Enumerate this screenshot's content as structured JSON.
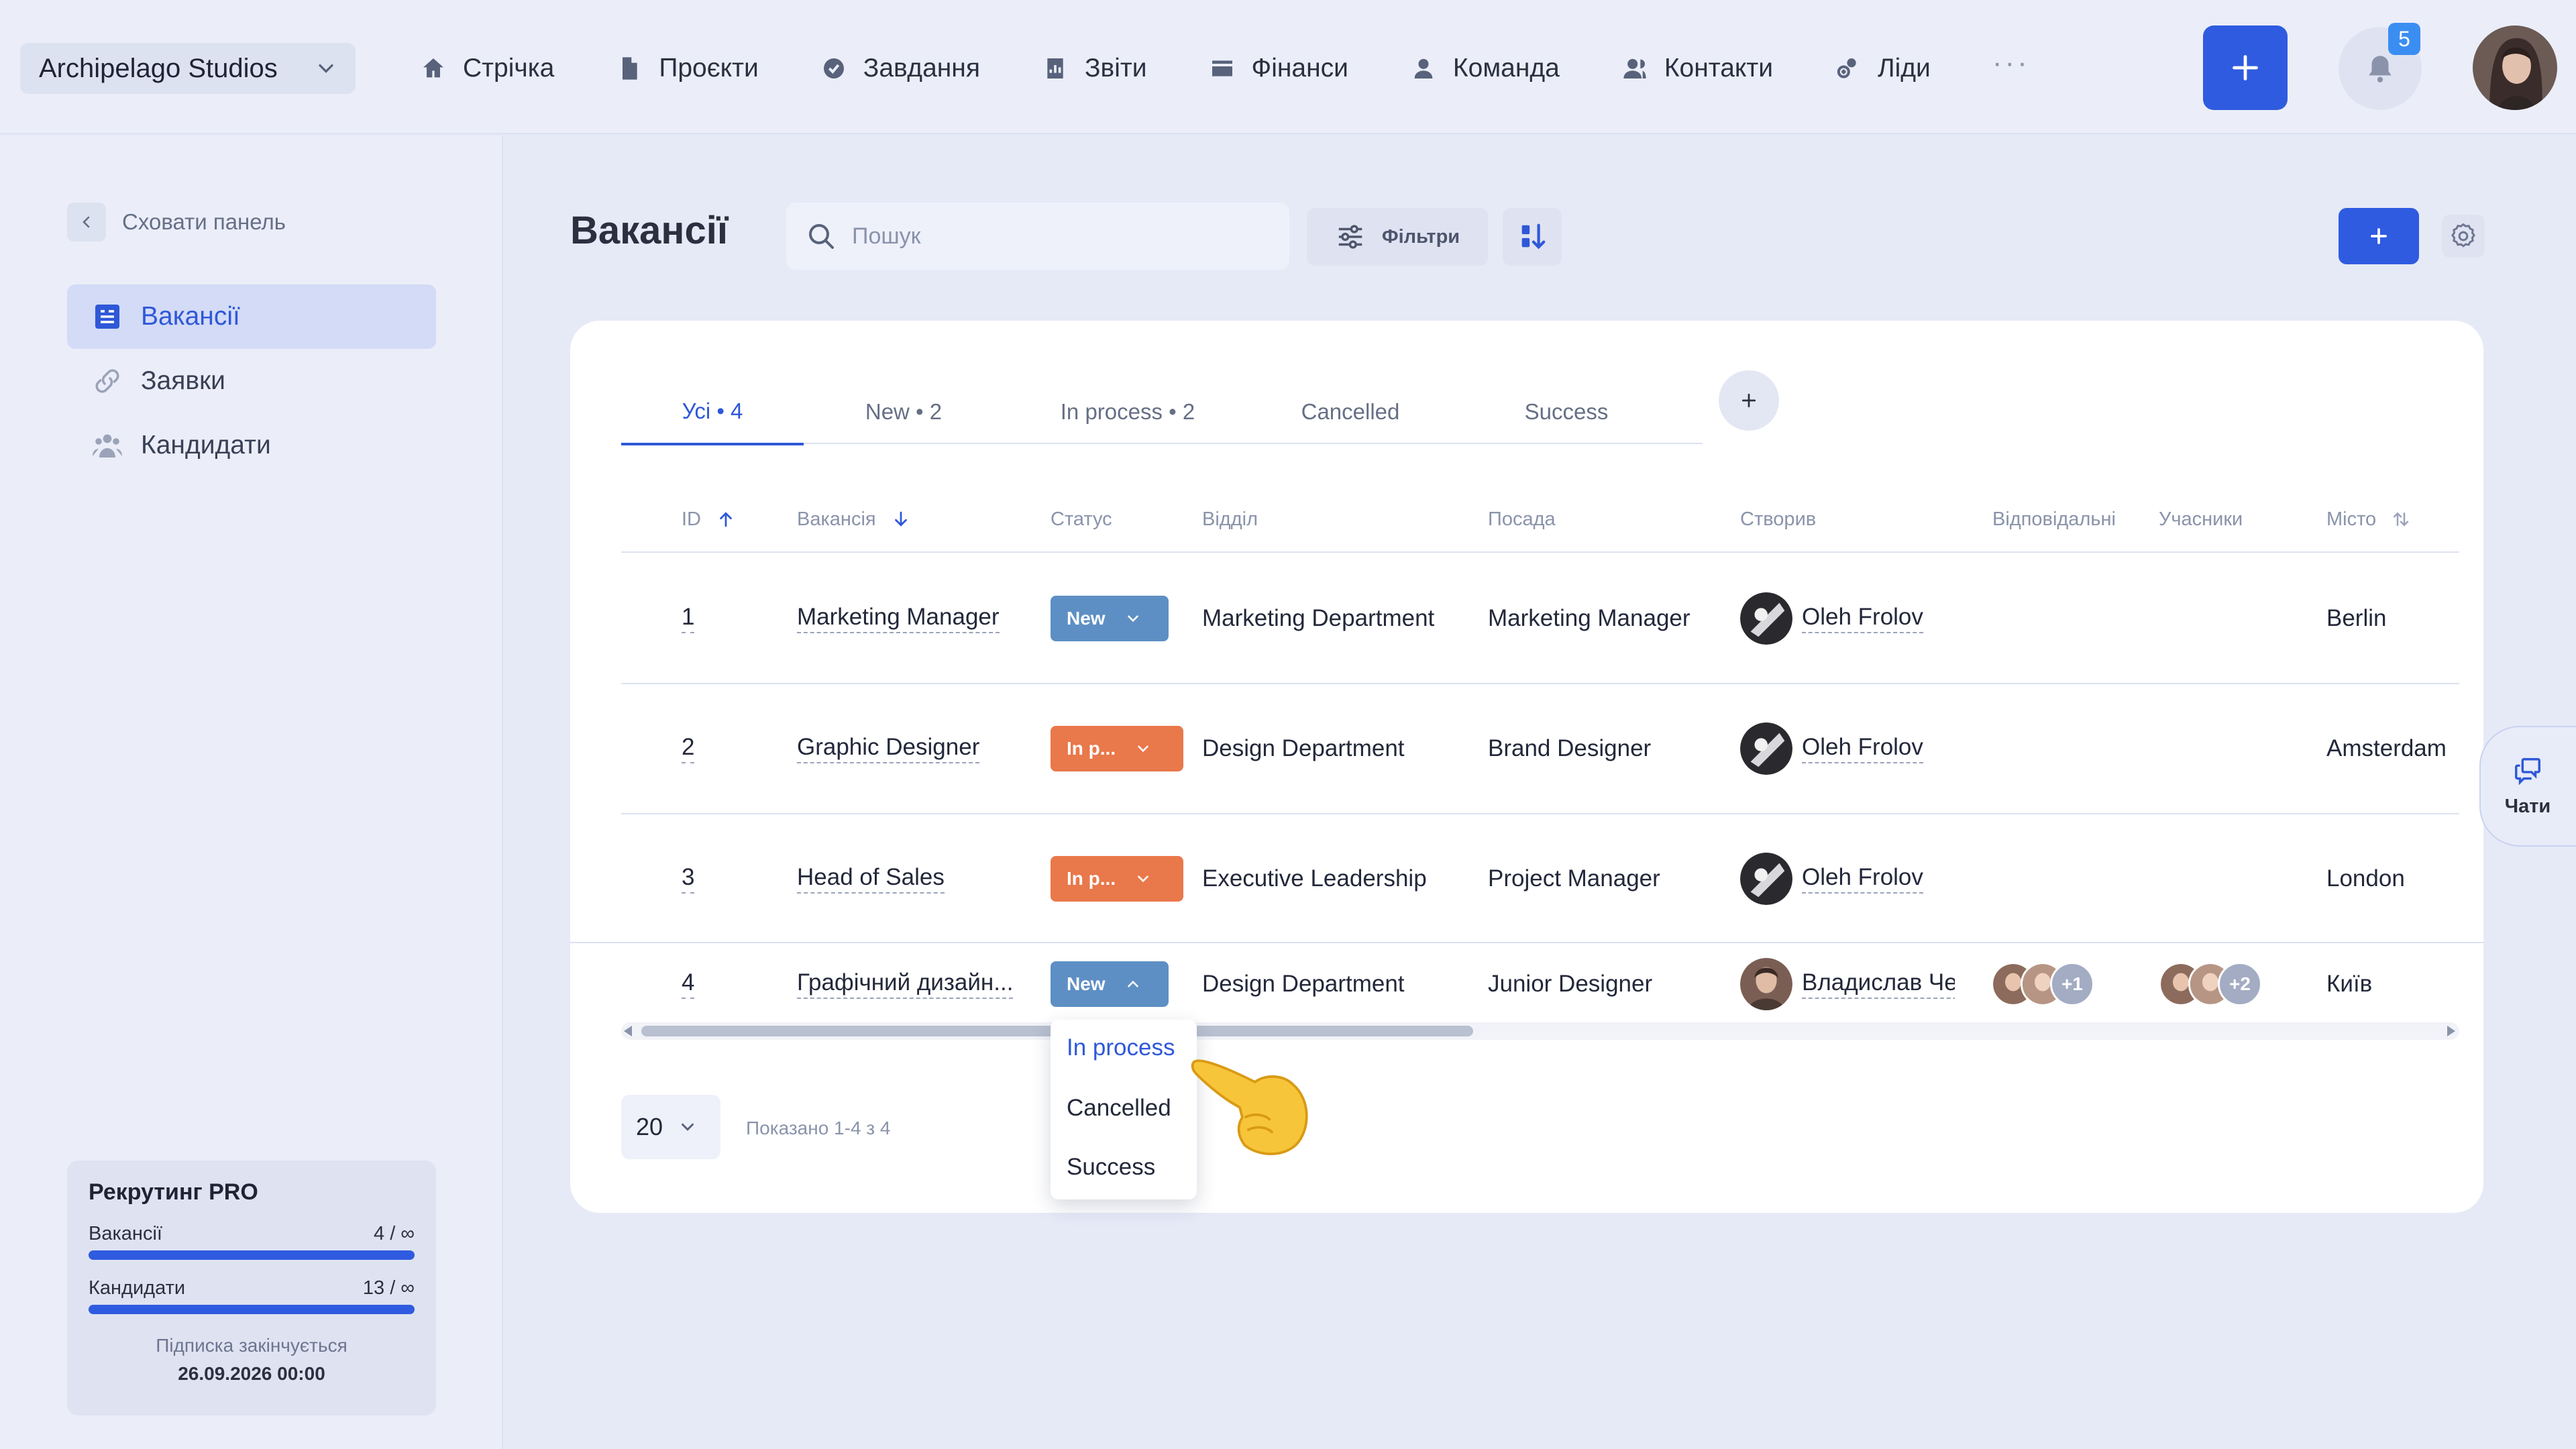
{
  "org": {
    "name": "Archipelago Studios"
  },
  "nav": [
    {
      "label": "Стрічка",
      "icon": "home-icon"
    },
    {
      "label": "Проєкти",
      "icon": "document-icon"
    },
    {
      "label": "Завдання",
      "icon": "check-circle-icon"
    },
    {
      "label": "Звіти",
      "icon": "report-icon"
    },
    {
      "label": "Фінанси",
      "icon": "wallet-icon"
    },
    {
      "label": "Команда",
      "icon": "user-icon"
    },
    {
      "label": "Контакти",
      "icon": "contacts-icon"
    },
    {
      "label": "Ліди",
      "icon": "leads-icon"
    }
  ],
  "nav_more": "···",
  "notifications": {
    "count": "5"
  },
  "sidebar": {
    "hide_label": "Сховати панель",
    "items": [
      {
        "label": "Вакансії",
        "active": true,
        "icon": "vacancies-icon"
      },
      {
        "label": "Заявки",
        "active": false,
        "icon": "link-icon"
      },
      {
        "label": "Кандидати",
        "active": false,
        "icon": "people-icon"
      }
    ],
    "plan": {
      "title": "Рекрутинг PRO",
      "rows": [
        {
          "label": "Вакансії",
          "value": "4 / ∞",
          "progress": 1.0
        },
        {
          "label": "Кандидати",
          "value": "13 / ∞",
          "progress": 1.0
        }
      ],
      "expires_label": "Підписка закінчується",
      "expires_date": "26.09.2026 00:00"
    }
  },
  "page": {
    "title": "Вакансії",
    "search_placeholder": "Пошук",
    "filters_label": "Фільтри"
  },
  "tabs": [
    {
      "label": "Усі • 4",
      "active": true
    },
    {
      "label": "New • 2",
      "active": false
    },
    {
      "label": "In process • 2",
      "active": false
    },
    {
      "label": "Cancelled",
      "active": false
    },
    {
      "label": "Success",
      "active": false
    }
  ],
  "table": {
    "columns": [
      "ID",
      "Вакансія",
      "Статус",
      "Відділ",
      "Посада",
      "Створив",
      "Відповідальні",
      "Учасники",
      "Місто"
    ],
    "rows": [
      {
        "id": "1",
        "vacancy": "Marketing Manager",
        "status": "New",
        "status_type": "new",
        "department": "Marketing Department",
        "position": "Marketing Manager",
        "creator": "Oleh Frolov",
        "responsible_more": "",
        "participants_more": "",
        "city": "Berlin"
      },
      {
        "id": "2",
        "vacancy": "Graphic Designer",
        "status": "In p...",
        "status_type": "in-process",
        "department": "Design Department",
        "position": "Brand Designer",
        "creator": "Oleh Frolov",
        "responsible_more": "",
        "participants_more": "",
        "city": "Amsterdam"
      },
      {
        "id": "3",
        "vacancy": "Head of Sales",
        "status": "In p...",
        "status_type": "in-process",
        "department": "Executive Leadership",
        "position": "Project Manager",
        "creator": "Oleh Frolov",
        "responsible_more": "",
        "participants_more": "",
        "city": "London"
      },
      {
        "id": "4",
        "vacancy": "Графічний дизайн...",
        "status": "New",
        "status_type": "new",
        "department": "Design Department",
        "position": "Junior Designer",
        "creator": "Владислав Че...",
        "responsible_more": "+1",
        "participants_more": "+2",
        "city": "Київ"
      }
    ]
  },
  "pagination": {
    "per_page": "20",
    "shown": "Показано 1-4 з 4"
  },
  "status_dropdown": {
    "options": [
      {
        "label": "In process",
        "selected": true
      },
      {
        "label": "Cancelled",
        "selected": false
      },
      {
        "label": "Success",
        "selected": false
      }
    ]
  },
  "chats": {
    "label": "Чати"
  },
  "colors": {
    "accent": "#2f5be0",
    "status_new": "#5e8fc4",
    "status_in_process": "#e9784b"
  }
}
